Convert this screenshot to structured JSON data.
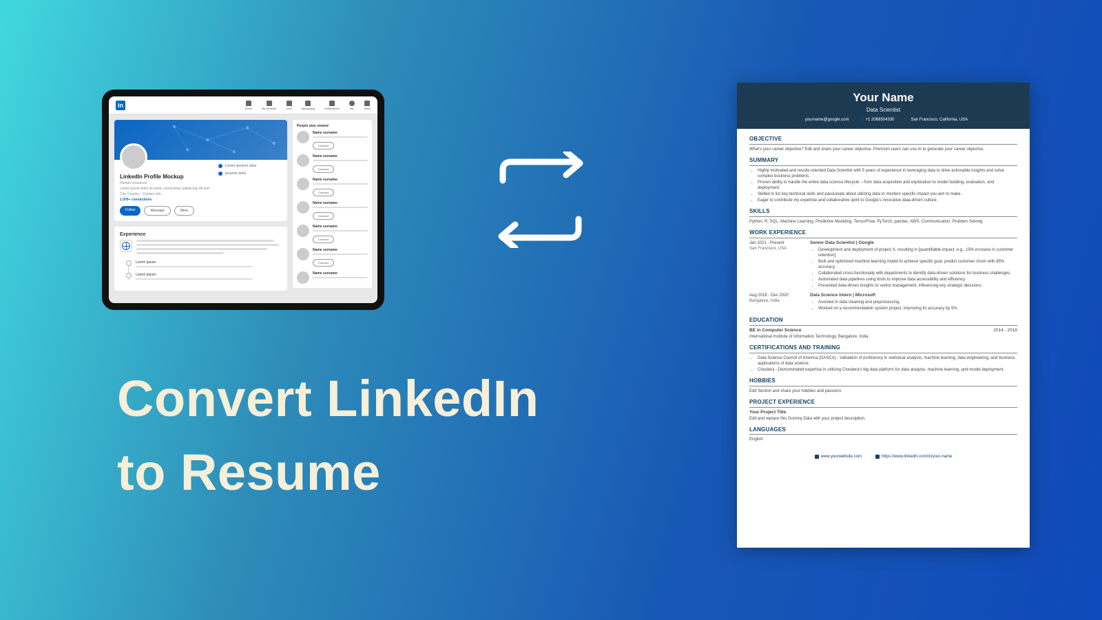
{
  "headline": {
    "line1": "Convert LinkedIn",
    "line2": " to Resume"
  },
  "linkedin": {
    "logo": "in",
    "nav": [
      "Home",
      "My Network",
      "Jobs",
      "Messaging",
      "Notifications",
      "Me",
      "More"
    ],
    "profile_name": "LinkedIn Profile Mockup",
    "profile_sub": "Human resources",
    "meta1": "Lorem ipsum dolor sit amet, consectetur adipiscing elit sed",
    "meta2": "City, Country · Contact info",
    "connections": "1,500+ connections",
    "btn_primary": "Follow",
    "btn_msg": "Message",
    "btn_more": "More",
    "bullet1": "Lorem ipsumre dolor",
    "bullet2": "Ipsumre dolor",
    "experience_title": "Experience",
    "tl1": "Lorem Ipsum",
    "tl2": "Lorem Ipsum",
    "side_title": "People also viewed",
    "sugg_name": "Name surname",
    "connect": "Connect"
  },
  "resume": {
    "name": "Your Name",
    "role": "Data Scientist",
    "email": "yourname@google.com",
    "phone": "+1 2068504330",
    "location": "San Francisco, California, USA",
    "sections": {
      "objective": {
        "title": "OBJECTIVE",
        "text": "What's your career objective? Edit and share your career objective. Premium users can use AI to generate your career objective."
      },
      "summary": {
        "title": "SUMMARY",
        "items": [
          "Highly motivated and results-oriented Data Scientist with 5 years of experience in leveraging data to drive actionable insights and solve complex business problems.",
          "Proven ability to handle the entire data science lifecycle – from data acquisition and exploration to model building, evaluation, and deployment.",
          "Skilled in list key technical skills and passionate about utilizing data to mention specific impact you aim to make.",
          "Eager to contribute my expertise and collaborative spirit to Google's innovative data-driven culture."
        ]
      },
      "skills": {
        "title": "SKILLS",
        "text": "Python, R, SQL, Machine Learning, Predictive Modeling, TensorFlow, PyTorch, pandas, AWS, Communication, Problem Solving"
      },
      "work": {
        "title": "WORK EXPERIENCE",
        "jobs": [
          {
            "dates": "Jan 2021 - Present",
            "location": "San Francisco, USA",
            "title": "Senior Data Scientist | Google",
            "bullets": [
              "Development and deployment of project X, resulting in [quantifiable impact, e.g., 15% increase in customer retention].",
              "Built and optimized machine learning model to achieve specific goal, predict customer churn with 85% accuracy.",
              "Collaborated cross-functionally with departments to identify data-driven solutions for business challenges.",
              "Automated data pipelines using tools to improve data accessibility and efficiency.",
              "Presented data-driven insights to senior management, influencing key strategic decisions."
            ]
          },
          {
            "dates": "Aug 2018 - Dec 2020",
            "location": "Bangalore, India",
            "title": "Data Science Intern | Microsoft",
            "bullets": [
              "Assisted in data cleaning and preprocessing.",
              "Worked on a recommendation system project, improving its accuracy by 5%."
            ]
          }
        ]
      },
      "education": {
        "title": "EDUCATION",
        "degree": "BE in Computer Science",
        "years": "2014 - 2018",
        "school": "International Institute of Information Technology, Bangalore, India"
      },
      "certs": {
        "title": "CERTIFICATIONS AND TRAINING",
        "items": [
          "Data Science Council of America (DASCA) - Validation of proficiency in statistical analysis, machine learning, data engineering, and business applications of data science.",
          "Cloudera - Demonstrated expertise in utilizing Cloudera's big data platform for data analysis, machine learning, and model deployment."
        ]
      },
      "hobbies": {
        "title": "HOBBIES",
        "text": "Edit Section and share your hobbies and passions"
      },
      "project": {
        "title": "PROJECT EXPERIENCE",
        "ptitle": "Your Project Title",
        "ptext": "Edit and replace this Dummy Data with your project description."
      },
      "languages": {
        "title": "LANGUAGES",
        "text": "English"
      }
    },
    "footer": {
      "website": "www.yourwebsite.com",
      "linkedin": "https://www.linkedin.com/in/your-name"
    }
  }
}
